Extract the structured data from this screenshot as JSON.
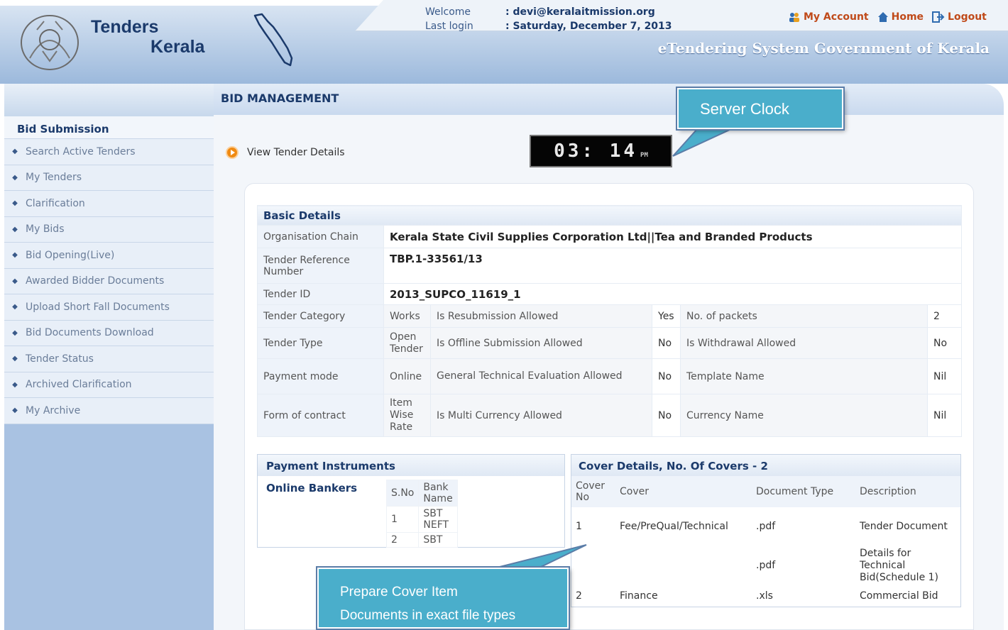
{
  "header": {
    "title_line1": "Tenders",
    "title_line2": "Kerala",
    "welcome_label": "Welcome",
    "welcome_value": ": devi@keralaitmission.org",
    "lastlogin_label": "Last login",
    "lastlogin_value": ": Saturday, December 7, 2013",
    "links": {
      "my_account": "My Account",
      "home": "Home",
      "logout": "Logout"
    },
    "system_title": "eTendering System Government of Kerala"
  },
  "sidebar": {
    "heading": "Bid Submission",
    "items": [
      "Search Active Tenders",
      "My Tenders",
      "Clarification",
      "My Bids",
      "Bid Opening(Live)",
      "Awarded Bidder Documents",
      "Upload Short Fall Documents",
      "Bid Documents Download",
      "Tender Status",
      "Archived Clarification",
      "My Archive"
    ]
  },
  "main": {
    "title": "BID MANAGEMENT",
    "view_tender": "View Tender Details",
    "clock": {
      "time": "03: 14",
      "ampm": "PM"
    },
    "callouts": {
      "server_clock": "Server Clock",
      "cover_line1": "Prepare Cover Item",
      "cover_line2": "Documents in exact file types"
    }
  },
  "basic_details": {
    "caption": "Basic Details",
    "org_chain_label": "Organisation Chain",
    "org_chain": "Kerala State Civil Supplies Corporation Ltd||Tea and Branded Products",
    "ref_label": "Tender Reference Number",
    "ref": "TBP.1-33561/13",
    "id_label": "Tender ID",
    "id": "2013_SUPCO_11619_1",
    "rows": [
      {
        "l1": "Tender Category",
        "v1": "Works",
        "l2": "Is Resubmission Allowed",
        "v2": "Yes",
        "l3": "No. of packets",
        "v3": "2"
      },
      {
        "l1": "Tender Type",
        "v1": "Open Tender",
        "l2": "Is Offline Submission Allowed",
        "v2": "No",
        "l3": "Is Withdrawal Allowed",
        "v3": "No"
      },
      {
        "l1": "Payment mode",
        "v1": "Online",
        "l2": "General Technical Evaluation Allowed",
        "v2": "No",
        "l3": "Template Name",
        "v3": "Nil"
      },
      {
        "l1": "Form of contract",
        "v1": "Item Wise Rate",
        "l2": "Is Multi Currency Allowed",
        "v2": "No",
        "l3": "Currency Name",
        "v3": "Nil"
      }
    ]
  },
  "payment_instruments": {
    "caption": "Payment Instruments",
    "online_bankers": "Online Bankers",
    "col_sno": "S.No",
    "col_bank": "Bank Name",
    "banks": [
      {
        "sno": "1",
        "name": "SBT NEFT"
      },
      {
        "sno": "2",
        "name": "SBT"
      }
    ]
  },
  "cover_details": {
    "caption": "Cover Details, No. Of Covers - 2",
    "col_no": "Cover No",
    "col_cover": "Cover",
    "col_type": "Document Type",
    "col_desc": "Description",
    "rows": [
      {
        "no": "1",
        "cover": "Fee/PreQual/Technical",
        "type": ".pdf",
        "desc": "Tender Document"
      },
      {
        "no": "",
        "cover": "",
        "type": ".pdf",
        "desc": "Details for Technical Bid(Schedule 1)"
      },
      {
        "no": "2",
        "cover": "Finance",
        "type": ".xls",
        "desc": "Commercial Bid"
      }
    ]
  },
  "colors": {
    "accent": "#1b3a6b",
    "callout": "#4aaecb",
    "link": "#c04a1a"
  }
}
